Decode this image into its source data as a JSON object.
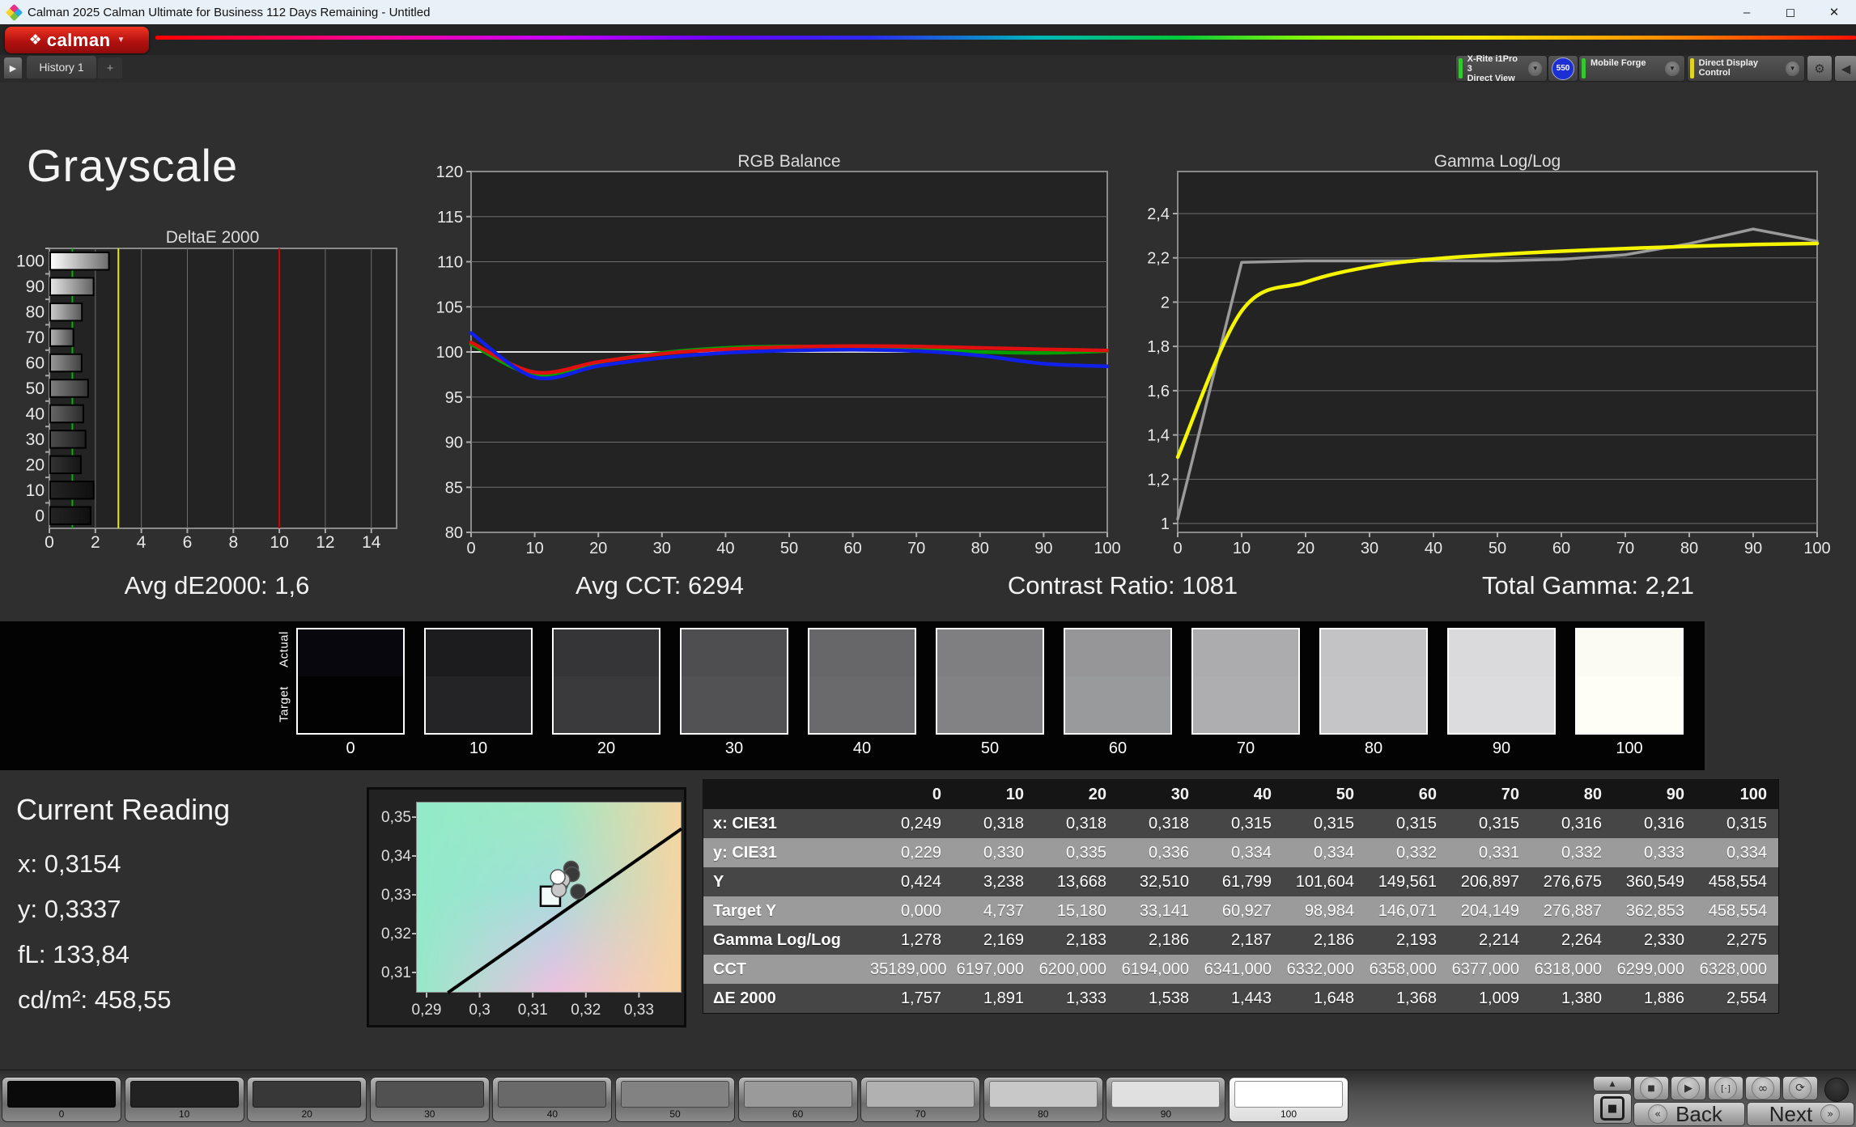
{
  "window": {
    "title": "Calman 2025 Calman Ultimate for Business 112 Days Remaining  - Untitled",
    "minimize": "–",
    "maximize": "◻",
    "close": "✕"
  },
  "header": {
    "logo_diamond": "❖",
    "logo_text": "calman",
    "logo_caret": "▼"
  },
  "tab_bar": {
    "expand_arrow": "▶",
    "history_tab": "History 1",
    "add_tab": "+"
  },
  "meters": {
    "meter1_line1": "X-Rite i1Pro 3",
    "meter1_line2": "Direct View",
    "meter1_status_color": "#35c72f",
    "meter1_badge": "550",
    "meter2_label": "Mobile Forge",
    "meter2_status_color": "#35c72f",
    "meter3_label": "Direct Display Control",
    "meter3_status_color": "#e0d420",
    "caret": "▼",
    "gear": "⚙",
    "collapse_arrow": "◀"
  },
  "page": {
    "title": "Grayscale"
  },
  "stats": {
    "avg_de2000": "Avg dE2000: 1,6",
    "avg_cct": "Avg CCT: 6294",
    "contrast_ratio": "Contrast Ratio: 1081",
    "total_gamma": "Total Gamma: 2,21"
  },
  "chart_data": [
    {
      "id": "deltae",
      "type": "bar",
      "orientation": "horizontal",
      "title": "DeltaE 2000",
      "categories": [
        100,
        90,
        80,
        70,
        60,
        50,
        40,
        30,
        20,
        10,
        0
      ],
      "values": [
        2.554,
        1.886,
        1.38,
        1.009,
        1.368,
        1.648,
        1.443,
        1.538,
        1.333,
        1.891,
        1.757
      ],
      "xlim": [
        0,
        15.1
      ],
      "xticks": [
        "0",
        "2",
        "4",
        "6",
        "8",
        "10",
        "12",
        "14"
      ],
      "marker_lines": [
        {
          "name": "pass",
          "color": "#00b400",
          "x": 1
        },
        {
          "name": "warn",
          "color": "#e6e600",
          "x": 3
        },
        {
          "name": "fail",
          "color": "#d40000",
          "x": 10
        }
      ]
    },
    {
      "id": "rgb_balance",
      "type": "line",
      "title": "RGB Balance",
      "x": [
        0,
        10,
        20,
        30,
        40,
        50,
        60,
        70,
        80,
        90,
        100
      ],
      "xticks": [
        "0",
        "10",
        "20",
        "30",
        "40",
        "50",
        "60",
        "70",
        "80",
        "90",
        "100"
      ],
      "ylim": [
        80,
        120
      ],
      "yticks": [
        "120",
        "115",
        "110",
        "105",
        "100",
        "95",
        "90",
        "85",
        "80"
      ],
      "reference_line": 100,
      "series": [
        {
          "name": "Green",
          "color": "#00a000",
          "smooth": true,
          "values": [
            100.85,
            97.5,
            98.85,
            99.9,
            100.45,
            100.6,
            100.5,
            100.3,
            100.0,
            99.9,
            100.1
          ]
        },
        {
          "name": "Red",
          "color": "#e01010",
          "smooth": true,
          "values": [
            101.05,
            97.75,
            98.9,
            99.8,
            100.3,
            100.55,
            100.65,
            100.6,
            100.45,
            100.3,
            100.15
          ]
        },
        {
          "name": "Blue",
          "color": "#1020e8",
          "smooth": true,
          "values": [
            102.1,
            97.2,
            98.45,
            99.35,
            99.9,
            100.15,
            100.25,
            100.1,
            99.6,
            98.7,
            98.4
          ]
        }
      ]
    },
    {
      "id": "gamma",
      "type": "line",
      "title": "Gamma Log/Log",
      "x": [
        0,
        10,
        20,
        30,
        40,
        50,
        60,
        70,
        80,
        90,
        100
      ],
      "xticks": [
        "0",
        "10",
        "20",
        "30",
        "40",
        "50",
        "60",
        "70",
        "80",
        "90",
        "100"
      ],
      "ylim": [
        0.96,
        2.59
      ],
      "ytick_values": [
        2.4,
        2.2,
        2.0,
        1.8,
        1.6,
        1.4,
        1.2,
        1.0
      ],
      "yticks": [
        "2,4",
        "2,2",
        "2",
        "1,8",
        "1,6",
        "1,4",
        "1,2",
        "1"
      ],
      "series": [
        {
          "name": "Measured",
          "color": "#9a9a9a",
          "smooth": false,
          "values": [
            1.02,
            2.18,
            2.186,
            2.186,
            2.187,
            2.186,
            2.193,
            2.214,
            2.264,
            2.33,
            2.275
          ]
        },
        {
          "name": "Target",
          "color": "#f5f500",
          "smooth": true,
          "values": [
            1.3,
            1.96,
            2.09,
            2.16,
            2.195,
            2.215,
            2.23,
            2.242,
            2.252,
            2.26,
            2.265
          ]
        }
      ]
    },
    {
      "id": "cie_shift",
      "type": "scatter",
      "xticks": [
        "0,29",
        "0,3",
        "0,31",
        "0,32",
        "0,33"
      ],
      "yticks": [
        "0,35",
        "0,34",
        "0,33",
        "0,32",
        "0,31"
      ],
      "xlim": [
        0.288,
        0.338
      ],
      "ylim": [
        0.3045,
        0.354
      ],
      "locus_line": {
        "x1": 0.294,
        "y1": 0.3045,
        "x2": 0.338,
        "y2": 0.347
      },
      "target_square": {
        "x": 0.3133,
        "y": 0.3295
      },
      "points": [
        {
          "x": 0.3172,
          "y": 0.3367,
          "fill": "#3a3a3a"
        },
        {
          "x": 0.3174,
          "y": 0.3352,
          "fill": "#3a3a3a"
        },
        {
          "x": 0.3185,
          "y": 0.3307,
          "fill": "#3a3a3a"
        },
        {
          "x": 0.3152,
          "y": 0.3326,
          "fill": "#c8c8c8"
        },
        {
          "x": 0.3156,
          "y": 0.3337,
          "fill": "#c8c8c8"
        },
        {
          "x": 0.3149,
          "y": 0.3312,
          "fill": "#c8c8c8"
        },
        {
          "x": 0.3147,
          "y": 0.3345,
          "fill": "#ffffff"
        }
      ]
    }
  ],
  "strip": {
    "actual_label": "Actual",
    "target_label": "Target",
    "levels": [
      "0",
      "10",
      "20",
      "30",
      "40",
      "50",
      "60",
      "70",
      "80",
      "90",
      "100"
    ],
    "actual_colors": [
      "#07070d",
      "#1c1c1e",
      "#353537",
      "#4e4e50",
      "#676769",
      "#7f7f81",
      "#969698",
      "#acacae",
      "#c3c3c5",
      "#dadadc",
      "#fbfbf4"
    ],
    "target_colors": [
      "#020203",
      "#242426",
      "#3a3a3c",
      "#525254",
      "#6a6a6c",
      "#828284",
      "#999a9c",
      "#aeaeb0",
      "#c5c5c7",
      "#dcdcde",
      "#fffef6"
    ]
  },
  "current_reading": {
    "title": "Current Reading",
    "lines": [
      "x: 0,3154",
      "y: 0,3337",
      "fL: 133,84",
      "cd/m²: 458,55"
    ]
  },
  "table": {
    "columns": [
      "0",
      "10",
      "20",
      "30",
      "40",
      "50",
      "60",
      "70",
      "80",
      "90",
      "100"
    ],
    "rows": [
      {
        "label": "x: CIE31",
        "values": [
          "0,249",
          "0,318",
          "0,318",
          "0,318",
          "0,315",
          "0,315",
          "0,315",
          "0,315",
          "0,316",
          "0,316",
          "0,315"
        ]
      },
      {
        "label": "y: CIE31",
        "values": [
          "0,229",
          "0,330",
          "0,335",
          "0,336",
          "0,334",
          "0,334",
          "0,332",
          "0,331",
          "0,332",
          "0,333",
          "0,334"
        ]
      },
      {
        "label": "Y",
        "values": [
          "0,424",
          "3,238",
          "13,668",
          "32,510",
          "61,799",
          "101,604",
          "149,561",
          "206,897",
          "276,675",
          "360,549",
          "458,554"
        ]
      },
      {
        "label": "Target Y",
        "values": [
          "0,000",
          "4,737",
          "15,180",
          "33,141",
          "60,927",
          "98,984",
          "146,071",
          "204,149",
          "276,887",
          "362,853",
          "458,554"
        ]
      },
      {
        "label": "Gamma Log/Log",
        "values": [
          "1,278",
          "2,169",
          "2,183",
          "2,186",
          "2,187",
          "2,186",
          "2,193",
          "2,214",
          "2,264",
          "2,330",
          "2,275"
        ]
      },
      {
        "label": "CCT",
        "values": [
          "35189,000",
          "6197,000",
          "6200,000",
          "6194,000",
          "6341,000",
          "6332,000",
          "6358,000",
          "6377,000",
          "6318,000",
          "6299,000",
          "6328,000"
        ]
      },
      {
        "label": "ΔE 2000",
        "values": [
          "1,757",
          "1,891",
          "1,333",
          "1,538",
          "1,443",
          "1,648",
          "1,368",
          "1,009",
          "1,380",
          "1,886",
          "2,554"
        ]
      }
    ]
  },
  "bottom_bar": {
    "levels": [
      "0",
      "10",
      "20",
      "30",
      "40",
      "50",
      "60",
      "70",
      "80",
      "90",
      "100"
    ],
    "level_colors": [
      "#0a0a0a",
      "#222222",
      "#383838",
      "#515151",
      "#696969",
      "#828282",
      "#9a9a9a",
      "#b1b1b1",
      "#c8c8c8",
      "#e0e0e0",
      "#ffffff"
    ],
    "selected_level": "100",
    "icons": {
      "up": "▲",
      "pattern": "■",
      "stop": "■",
      "play": "▶",
      "read": "[·]",
      "infinity": "∞",
      "refresh": "⟳",
      "back_chevron": "«",
      "next_chevron": "»"
    },
    "back_label": "Back",
    "next_label": "Next"
  }
}
